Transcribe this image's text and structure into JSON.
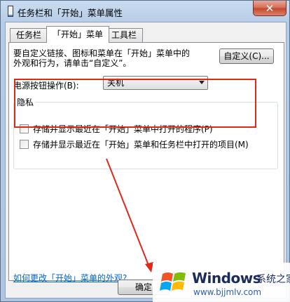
{
  "window": {
    "title": "任务栏和「开始」菜单属性",
    "close_glyph": "✕"
  },
  "tabs": [
    {
      "label": "任务栏",
      "active": false
    },
    {
      "label": "「开始」菜单",
      "active": true
    },
    {
      "label": "工具栏",
      "active": false
    }
  ],
  "start_menu": {
    "description_line1": "要自定义链接、图标和菜单在「开始」菜单中的",
    "description_line2": "外观和行为，请单击“自定义”。",
    "customize_button": "自定义(C)...",
    "power_label": "电源按钮操作(B):",
    "power_value": "关机"
  },
  "privacy": {
    "title": "隐私",
    "option1": "存储并显示最近在「开始」菜单中打开的程序(P)",
    "option2": "存储并显示最近在「开始」菜单和任务栏中打开的项目(M)",
    "option1_checked": false,
    "option2_checked": false
  },
  "help_link": "如何更改「开始」菜单的外观?",
  "ok_button": "确定",
  "watermark": {
    "brand": "Windows",
    "brand_cn": "系统之家",
    "url": "www.bjjmlv.com"
  },
  "colors": {
    "highlight": "#e0281b",
    "link": "#0066cc"
  }
}
